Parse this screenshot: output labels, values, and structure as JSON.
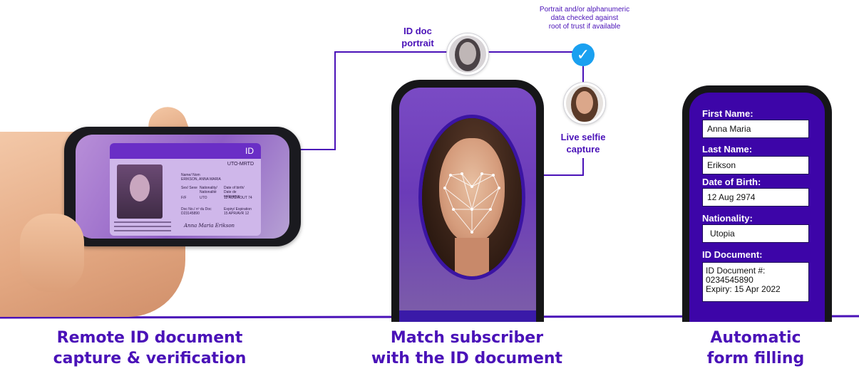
{
  "captions": {
    "left": [
      "Remote ID document",
      "capture & verification"
    ],
    "middle": [
      "Match subscriber",
      "with the ID document"
    ],
    "right": [
      "Automatic",
      "form filling"
    ]
  },
  "portrait_labels": {
    "id_doc": [
      "ID doc",
      "portrait"
    ],
    "selfie": [
      "Live selfie",
      "capture"
    ]
  },
  "verification_note": [
    "Portrait and/or alphanumeric",
    "data checked against",
    "root of trust if available"
  ],
  "check_icon": "checkmark-icon",
  "id_card": {
    "header": "ID",
    "code": "UTO-MRTD",
    "name_label": "Name/ Nom",
    "name": "ERIKSON, ANNA MARIA",
    "sex_label": "Sex/ Sexe",
    "sex": "F/F",
    "nationality_label": "Nationality/ Nationalité",
    "nationality": "UTO",
    "dob_label": "Date of birth/ Date de naissance",
    "dob": "12 AUG/AOUT 74",
    "doc_no_label": "Doc No./ nº du Doc",
    "doc_no": "D23145890",
    "expiry_label": "Expiry/ Expiration",
    "expiry": "15 APR/AVR 12",
    "signature": "Anna Maria Erikson"
  },
  "form": {
    "fields": [
      {
        "label": "First Name:",
        "value": "Anna Maria"
      },
      {
        "label": "Last Name:",
        "value": "Erikson"
      },
      {
        "label": "Date of Birth:",
        "value": "12 Aug 2974"
      },
      {
        "label": "Nationality:",
        "value": "Utopia"
      }
    ],
    "id_document": {
      "label": "ID Document:",
      "lines": [
        "ID Document #:",
        "0234545890",
        "Expiry: 15 Apr 2022"
      ]
    }
  },
  "colors": {
    "accent": "#4a12b8",
    "form_bg": "#3d05a8",
    "check": "#1aa0f0"
  }
}
